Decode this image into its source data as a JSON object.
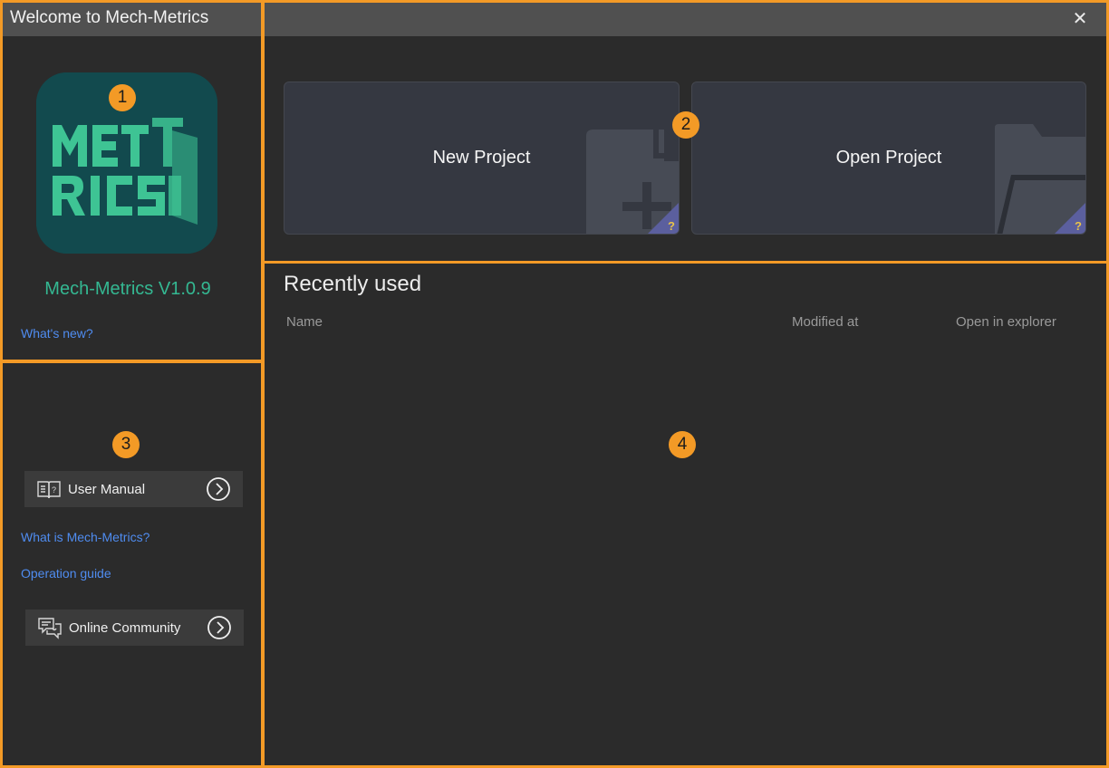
{
  "window": {
    "title": "Welcome to Mech-Metrics",
    "close_glyph": "✕"
  },
  "branding": {
    "logo_text_lines": [
      "MET",
      "RICS"
    ],
    "logo_colors": {
      "background": "#124a4e",
      "letters": "#3ec494"
    },
    "version": "Mech-Metrics V1.0.9",
    "whats_new": "What's new?"
  },
  "annotations": {
    "markers": [
      "1",
      "2",
      "3",
      "4"
    ],
    "color": "#f39a26"
  },
  "help": {
    "user_manual": {
      "label": "User Manual",
      "icon": "book-icon"
    },
    "what_is_link": "What is Mech-Metrics?",
    "operation_guide_link": "Operation guide",
    "online_community": {
      "label": "Online Community",
      "icon": "chat-icon"
    }
  },
  "projects": {
    "new": {
      "label": "New Project",
      "icon": "new-file-icon"
    },
    "open": {
      "label": "Open Project",
      "icon": "open-folder-icon"
    },
    "help_glyph": "?"
  },
  "recent": {
    "title": "Recently used",
    "columns": [
      "Name",
      "Modified at",
      "Open in explorer"
    ],
    "rows": []
  },
  "colors": {
    "accent_link": "#4f8cf0",
    "version_green": "#34b892",
    "card_bg": "#353841",
    "help_badge": "#5b5f9e"
  }
}
